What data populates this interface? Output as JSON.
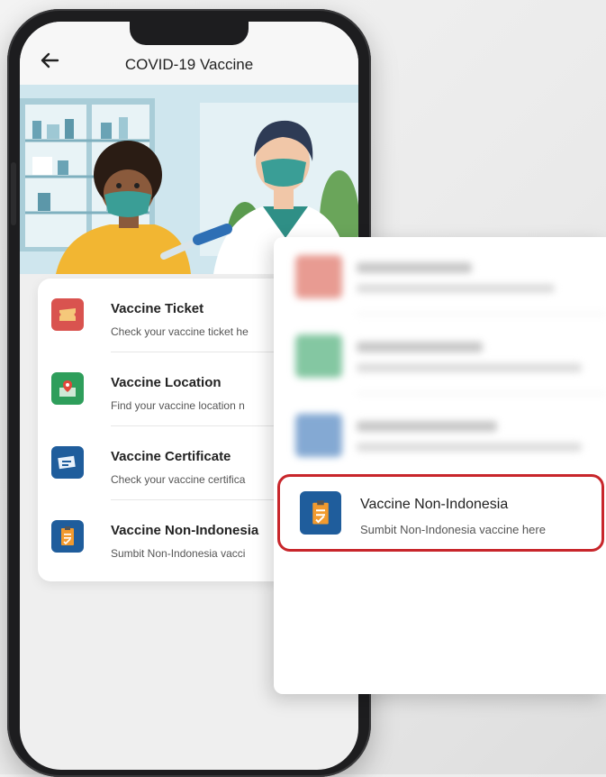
{
  "app": {
    "title": "COVID-19 Vaccine"
  },
  "menu": {
    "items": [
      {
        "title": "Vaccine Ticket",
        "subtitle": "Check your vaccine ticket he",
        "icon": "ticket-icon",
        "color": "#d9534f"
      },
      {
        "title": "Vaccine Location",
        "subtitle": "Find your vaccine location n",
        "icon": "map-location-icon",
        "color": "#2e9e5b"
      },
      {
        "title": "Vaccine Certificate",
        "subtitle": "Check your vaccine certifica",
        "icon": "certificate-icon",
        "color": "#1f5d9c"
      },
      {
        "title": "Vaccine Non-Indonesia",
        "subtitle": "Sumbit Non-Indonesia vacci",
        "icon": "clipboard-icon",
        "color": "#1f5d9c"
      }
    ]
  },
  "zoom": {
    "highlighted": {
      "title": "Vaccine Non-Indonesia",
      "subtitle": "Sumbit Non-Indonesia vaccine here",
      "icon": "clipboard-icon",
      "highlight_color": "#c8262b"
    }
  }
}
